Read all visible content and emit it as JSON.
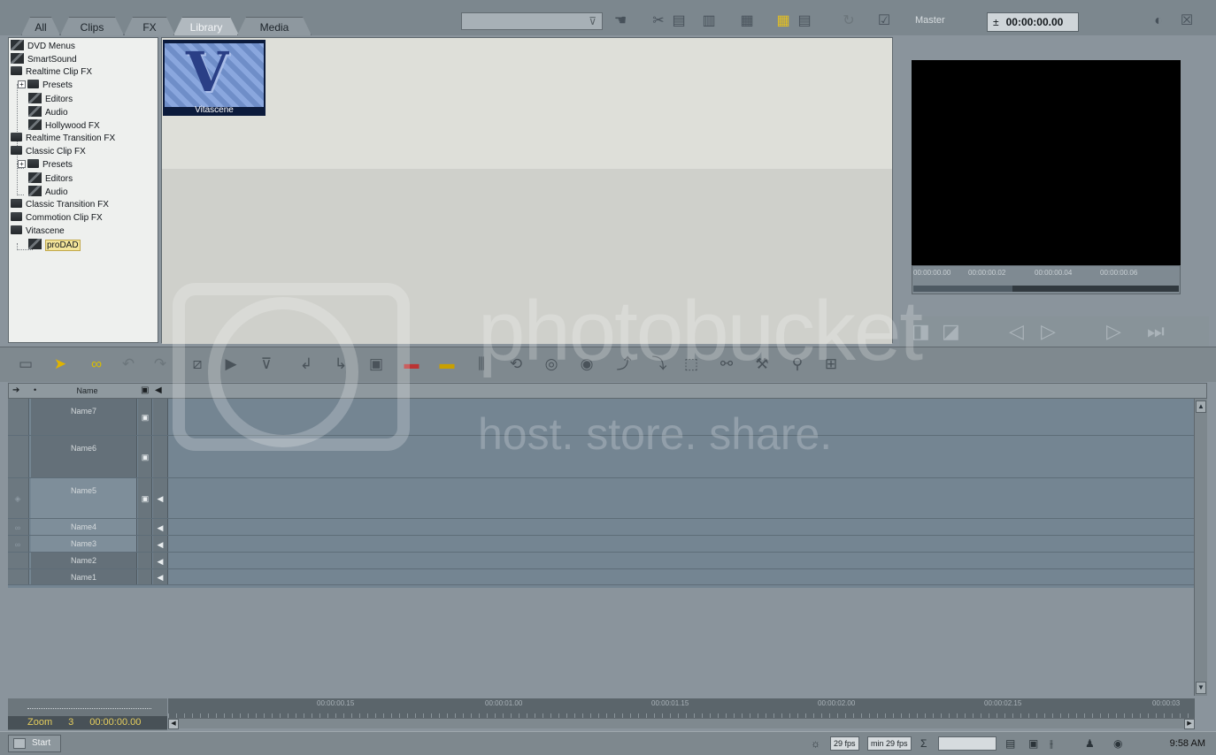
{
  "tabs": [
    {
      "label": "All",
      "active": false
    },
    {
      "label": "Clips",
      "active": false
    },
    {
      "label": "FX",
      "active": false
    },
    {
      "label": "Library",
      "active": true
    },
    {
      "label": "Media",
      "active": false
    }
  ],
  "top_toolbar": {
    "search_filter_icon": "funnel-icon",
    "icons": [
      "hand-icon",
      "scissors-icon",
      "copy-icon",
      "paste-icon",
      "trash-icon",
      "grid-view-icon",
      "list-view-icon",
      "refresh-icon",
      "checkbox-icon"
    ],
    "master_label": "Master",
    "timecode": "00:00:00.00"
  },
  "tree": [
    {
      "label": "DVD Menus",
      "icon": "layers-icon",
      "depth": 0
    },
    {
      "label": "SmartSound",
      "icon": "layers-icon",
      "depth": 0
    },
    {
      "label": "Realtime Clip FX",
      "icon": "folder-icon",
      "depth": 0
    },
    {
      "label": "Presets",
      "icon": "folder-icon",
      "depth": 1,
      "expander": "+"
    },
    {
      "label": "Editors",
      "icon": "layers-icon",
      "depth": 2
    },
    {
      "label": "Audio",
      "icon": "layers-icon",
      "depth": 2
    },
    {
      "label": "Hollywood FX",
      "icon": "layers-icon",
      "depth": 2
    },
    {
      "label": "Realtime Transition FX",
      "icon": "folder-icon",
      "depth": 0
    },
    {
      "label": "Classic Clip FX",
      "icon": "folder-icon",
      "depth": 0
    },
    {
      "label": "Presets",
      "icon": "folder-icon",
      "depth": 1,
      "expander": "+"
    },
    {
      "label": "Editors",
      "icon": "layers-icon",
      "depth": 2
    },
    {
      "label": "Audio",
      "icon": "layers-icon",
      "depth": 2
    },
    {
      "label": "Classic Transition FX",
      "icon": "folder-icon",
      "depth": 0
    },
    {
      "label": "Commotion Clip FX",
      "icon": "folder-icon",
      "depth": 0
    },
    {
      "label": "Vitascene",
      "icon": "folder-icon",
      "depth": 0
    },
    {
      "label": "proDAD",
      "icon": "layers-icon",
      "depth": 2,
      "selected": true
    }
  ],
  "library": {
    "items": [
      {
        "caption": "Vitascene",
        "glyph": "V"
      }
    ]
  },
  "preview": {
    "ruler_timecodes": [
      "00:00:00.00",
      "00:00:00.02",
      "00:00:00.04",
      "00:00:00.06"
    ],
    "transport_icons": [
      "mark-in-icon",
      "mark-out-icon",
      "prev-frame-icon",
      "next-frame-icon",
      "play-icon",
      "go-to-end-icon"
    ]
  },
  "timeline_toolbar": {
    "icons": [
      "folder-icon",
      "pointer-icon",
      "link-icon",
      "undo-icon",
      "redo-icon",
      "razor-icon",
      "slip-icon",
      "filter-icon",
      "insert-icon",
      "overwrite-icon",
      "fx-icon",
      "lift-icon",
      "extract-icon",
      "split-icon",
      "loop-icon",
      "record-icon",
      "mix-icon",
      "keyframe-icon",
      "keyframe-remove-icon",
      "box-icon",
      "group-icon",
      "export-icon",
      "zoom-icon",
      "fit-icon"
    ]
  },
  "tracks": {
    "header_name": "Name",
    "rows": [
      {
        "name": "Name7",
        "video": true,
        "audio": false,
        "lock": ""
      },
      {
        "name": "Name6",
        "video": true,
        "audio": false,
        "lock": ""
      },
      {
        "name": "Name5",
        "video": true,
        "audio": true,
        "lock": "shield-icon"
      },
      {
        "name": "Name4",
        "video": false,
        "audio": true,
        "lock": "link-icon"
      },
      {
        "name": "Name3",
        "video": false,
        "audio": true,
        "lock": "link-icon"
      },
      {
        "name": "Name2",
        "video": false,
        "audio": true,
        "lock": ""
      },
      {
        "name": "Name1",
        "video": false,
        "audio": true,
        "lock": ""
      }
    ]
  },
  "zoom": {
    "label": "Zoom",
    "level": "3",
    "timecode": "00:00:00.00"
  },
  "ruler": {
    "timecodes": [
      "00:00:00.15",
      "00:00:01.00",
      "00:00:01.15",
      "00:00:02.00",
      "00:00:02.15",
      "00:00:03"
    ]
  },
  "taskbar": {
    "start_label": "Start",
    "fps": "29 fps",
    "min_fps": "min 29 fps",
    "sigma": "Σ",
    "clock": "9:58 AM"
  },
  "watermark": {
    "big": "photobucket",
    "small": "host. store. share."
  }
}
